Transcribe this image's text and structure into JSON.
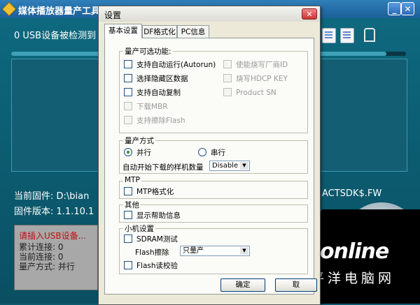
{
  "main": {
    "title": "媒体播放器量产工具",
    "usb_status": "0 USB设备被检测到 0",
    "firmware_label": "当前固件: D:\\bian",
    "firmware_tail": "ACTSDK$.FW",
    "version_label": "固件版本: 1.1.10.1",
    "progress": 0.95,
    "info": {
      "insert_msg": "请插入USB设备...",
      "total": "累计连接:  0",
      "current": "当前连接:  0",
      "mode": "量产方式: 并行"
    },
    "watermark": {
      "main": "PConline",
      "sub": "太平洋电脑网"
    }
  },
  "dialog": {
    "title": "设置",
    "close": "✕",
    "tabs": [
      "基本设置",
      "DF格式化",
      "PC信息"
    ],
    "options_group": {
      "title": "量产可选功能:",
      "left": [
        {
          "label": "支持自动运行(Autorun)",
          "enabled": true
        },
        {
          "label": "选择隐藏区数据",
          "enabled": true
        },
        {
          "label": "支持自动复制",
          "enabled": true
        },
        {
          "label": "下载MBR",
          "enabled": false
        },
        {
          "label": "支持擦除Flash",
          "enabled": false
        }
      ],
      "right": [
        {
          "label": "使能烧写厂商ID",
          "enabled": false
        },
        {
          "label": "烧写HDCP KEY",
          "enabled": false
        },
        {
          "label": "Product SN",
          "enabled": false
        }
      ]
    },
    "mode_group": {
      "title": "量产方式",
      "parallel": "并行",
      "serial": "串行",
      "auto_label": "自动开始下载的样机数量",
      "auto_value": "Disable"
    },
    "mtp_group": {
      "title": "MTP",
      "checkbox": "MTP格式化"
    },
    "other_group": {
      "title": "其他",
      "checkbox": "显示帮助信息"
    },
    "mini_group": {
      "title": "小机设置",
      "sdram": "SDRAM测试",
      "flash_label": "Flash擦除",
      "flash_value": "只量产",
      "flash_verify": "Flash读校验"
    },
    "ok": "确定",
    "cancel": "取"
  },
  "colors": {
    "accent": "#0e6a80",
    "dialog_bg": "#ece9d8",
    "title_blue": "#2f7fb8"
  }
}
